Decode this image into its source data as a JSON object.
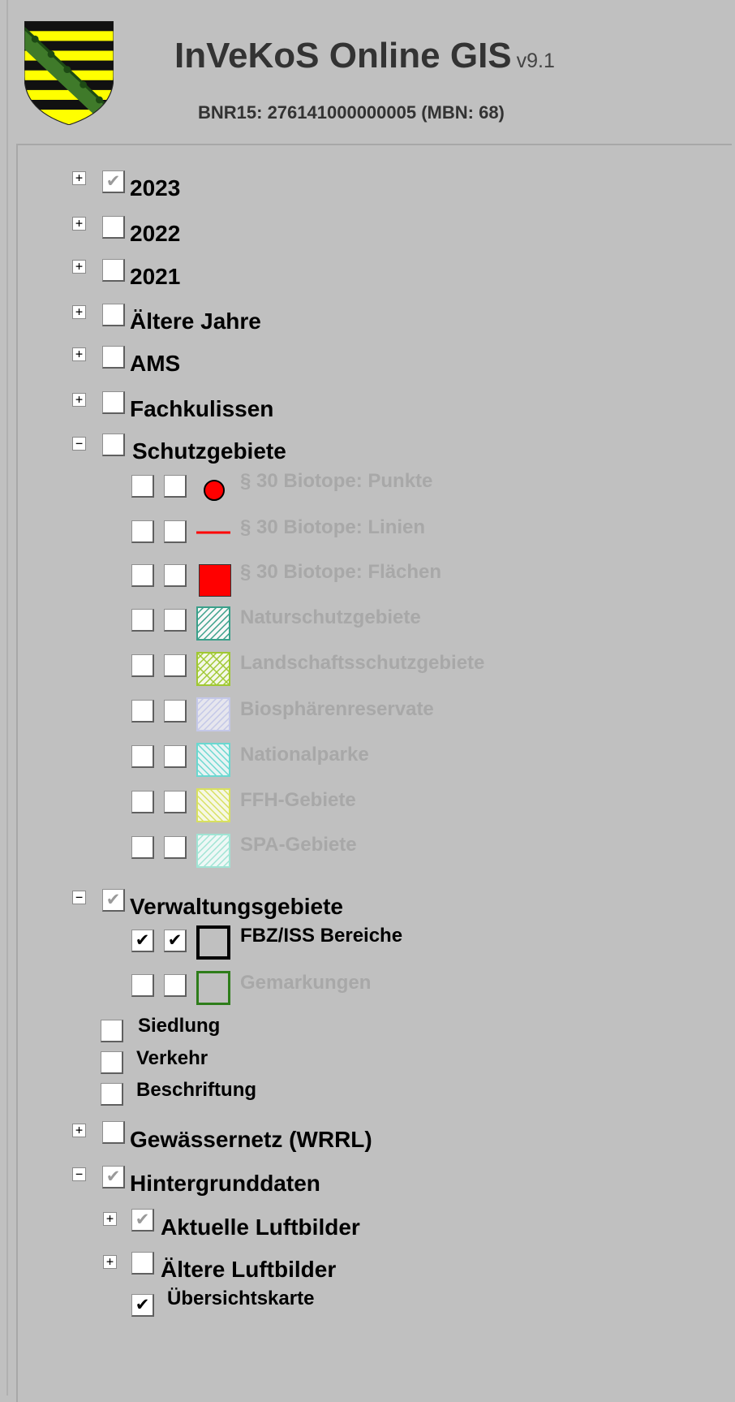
{
  "header": {
    "title": "InVeKoS Online GIS",
    "version": "v9.1",
    "bnr": "BNR15: 276141000000005 (MBN: 68)"
  },
  "layers": {
    "y2023": {
      "label": "2023",
      "checked": true,
      "expand": "+"
    },
    "y2022": {
      "label": "2022",
      "checked": false,
      "expand": "+"
    },
    "y2021": {
      "label": "2021",
      "checked": false,
      "expand": "+"
    },
    "older": {
      "label": "Ältere Jahre",
      "checked": false,
      "expand": "+"
    },
    "ams": {
      "label": "AMS",
      "checked": false,
      "expand": "+"
    },
    "fach": {
      "label": "Fachkulissen",
      "checked": false,
      "expand": "+"
    },
    "schutz": {
      "label": "Schutzgebiete",
      "checked": false,
      "expand": "−",
      "items": [
        {
          "label": "§ 30 Biotope: Punkte",
          "legend": "red-dot-icon",
          "color": "#ff0000"
        },
        {
          "label": "§ 30 Biotope: Linien",
          "legend": "red-line-icon",
          "color": "#ff0000"
        },
        {
          "label": "§ 30 Biotope: Flächen",
          "legend": "red-square-icon",
          "color": "#ff0000"
        },
        {
          "label": "Naturschutzgebiete",
          "legend": "hatch-teal-icon",
          "color": "#3aa08a"
        },
        {
          "label": "Landschaftsschutzgebiete",
          "legend": "hatch-yellowgreen-icon",
          "color": "#a0c832"
        },
        {
          "label": "Biosphärenreservate",
          "legend": "hatch-lavender-icon",
          "color": "#c4c8e8"
        },
        {
          "label": "Nationalparke",
          "legend": "hatch-cyan-icon",
          "color": "#6ad8d0"
        },
        {
          "label": "FFH-Gebiete",
          "legend": "hatch-yellow-icon",
          "color": "#d8e060"
        },
        {
          "label": "SPA-Gebiete",
          "legend": "hatch-mint-icon",
          "color": "#a0e4d4"
        }
      ]
    },
    "verw": {
      "label": "Verwaltungsgebiete",
      "checked": true,
      "expand": "−",
      "fbz": {
        "label": "FBZ/ISS Bereiche",
        "legend": "black-outline-square-icon",
        "color": "#000000"
      },
      "gemark": {
        "label": "Gemarkungen",
        "legend": "green-outline-square-icon",
        "color": "#2e7d1a"
      }
    },
    "siedlung": {
      "label": "Siedlung"
    },
    "verkehr": {
      "label": "Verkehr"
    },
    "beschrift": {
      "label": "Beschriftung"
    },
    "gewaesser": {
      "label": "Gewässernetz (WRRL)",
      "checked": false,
      "expand": "+"
    },
    "hinter": {
      "label": "Hintergrunddaten",
      "checked": true,
      "expand": "−",
      "aktuell": {
        "label": "Aktuelle Luftbilder",
        "checked": true,
        "expand": "+"
      },
      "aeltere": {
        "label": "Ältere Luftbilder",
        "checked": false,
        "expand": "+"
      },
      "uebersicht": {
        "label": "Übersichtskarte",
        "checked": true
      }
    }
  },
  "glyphs": {
    "check": "✔",
    "plus": "+",
    "minus": "−"
  },
  "colors": {
    "background": "#c0c0c0",
    "disabled_text": "#a8a8a8",
    "crest_yellow": "#ffff00",
    "crest_black": "#111111",
    "crest_green": "#3f7a2a"
  }
}
